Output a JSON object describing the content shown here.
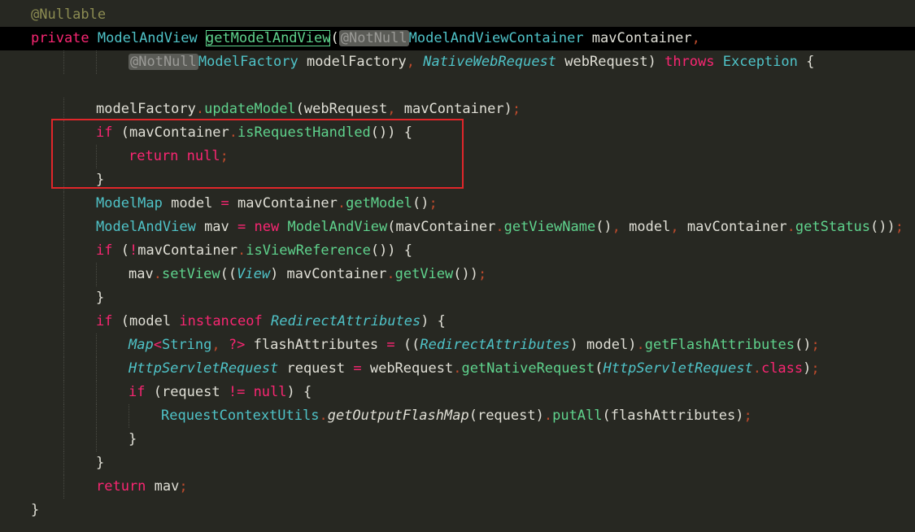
{
  "editor": {
    "language": "Java",
    "highlight_box_color": "#e0262a",
    "lines": [
      {
        "indent": 0,
        "tokens": [
          {
            "t": "@Nullable",
            "c": "ann"
          }
        ]
      },
      {
        "indent": 0,
        "current": true,
        "tokens": [
          {
            "t": "private ",
            "c": "kw"
          },
          {
            "t": "ModelAndView ",
            "c": "ty"
          },
          {
            "t": "getModelAndView",
            "c": "fn",
            "m": 1
          },
          {
            "t": "(",
            "c": "punc"
          },
          {
            "t": "@NotNull",
            "c": "chip"
          },
          {
            "t": "ModelAndViewContainer ",
            "c": "ty"
          },
          {
            "t": "mavContainer",
            "c": "id"
          },
          {
            "t": ",",
            "c": "sep"
          }
        ]
      },
      {
        "indent": 3,
        "tokens": [
          {
            "t": "@NotNull",
            "c": "chip"
          },
          {
            "t": "ModelFactory ",
            "c": "ty"
          },
          {
            "t": "modelFactory",
            "c": "id"
          },
          {
            "t": ", ",
            "c": "sep"
          },
          {
            "t": "NativeWebRequest ",
            "c": "ital"
          },
          {
            "t": "webRequest) ",
            "c": "id"
          },
          {
            "t": "throws ",
            "c": "kw"
          },
          {
            "t": "Exception ",
            "c": "ty"
          },
          {
            "t": "{",
            "c": "punc"
          }
        ]
      },
      {
        "indent": 0,
        "tokens": []
      },
      {
        "indent": 2,
        "tokens": [
          {
            "t": "modelFactory",
            "c": "id"
          },
          {
            "t": ".",
            "c": "sep"
          },
          {
            "t": "updateModel",
            "c": "fn"
          },
          {
            "t": "(webRequest",
            "c": "id"
          },
          {
            "t": ", ",
            "c": "sep"
          },
          {
            "t": "mavContainer)",
            "c": "id"
          },
          {
            "t": ";",
            "c": "sep"
          }
        ]
      },
      {
        "indent": 2,
        "tokens": [
          {
            "t": "if ",
            "c": "kw"
          },
          {
            "t": "(mavContainer",
            "c": "id"
          },
          {
            "t": ".",
            "c": "sep"
          },
          {
            "t": "isRequestHandled",
            "c": "fn"
          },
          {
            "t": "()) {",
            "c": "punc"
          }
        ]
      },
      {
        "indent": 3,
        "tokens": [
          {
            "t": "return ",
            "c": "kw"
          },
          {
            "t": "null",
            "c": "kw"
          },
          {
            "t": ";",
            "c": "sep"
          }
        ]
      },
      {
        "indent": 2,
        "tokens": [
          {
            "t": "}",
            "c": "punc"
          }
        ]
      },
      {
        "indent": 2,
        "tokens": [
          {
            "t": "ModelMap ",
            "c": "ty"
          },
          {
            "t": "model ",
            "c": "id"
          },
          {
            "t": "= ",
            "c": "kw"
          },
          {
            "t": "mavContainer",
            "c": "id"
          },
          {
            "t": ".",
            "c": "sep"
          },
          {
            "t": "getModel",
            "c": "fn"
          },
          {
            "t": "()",
            "c": "punc"
          },
          {
            "t": ";",
            "c": "sep"
          }
        ]
      },
      {
        "indent": 2,
        "tokens": [
          {
            "t": "ModelAndView ",
            "c": "ty"
          },
          {
            "t": "mav ",
            "c": "id"
          },
          {
            "t": "= ",
            "c": "kw"
          },
          {
            "t": "new ",
            "c": "kw"
          },
          {
            "t": "ModelAndView",
            "c": "fn"
          },
          {
            "t": "(mavContainer",
            "c": "id"
          },
          {
            "t": ".",
            "c": "sep"
          },
          {
            "t": "getViewName",
            "c": "fn"
          },
          {
            "t": "()",
            "c": "punc"
          },
          {
            "t": ", ",
            "c": "sep"
          },
          {
            "t": "model",
            "c": "id"
          },
          {
            "t": ", ",
            "c": "sep"
          },
          {
            "t": "mavContainer",
            "c": "id"
          },
          {
            "t": ".",
            "c": "sep"
          },
          {
            "t": "getStatus",
            "c": "fn"
          },
          {
            "t": "())",
            "c": "punc"
          },
          {
            "t": ";",
            "c": "sep"
          }
        ]
      },
      {
        "indent": 2,
        "tokens": [
          {
            "t": "if ",
            "c": "kw"
          },
          {
            "t": "(",
            "c": "punc"
          },
          {
            "t": "!",
            "c": "kw"
          },
          {
            "t": "mavContainer",
            "c": "id"
          },
          {
            "t": ".",
            "c": "sep"
          },
          {
            "t": "isViewReference",
            "c": "fn"
          },
          {
            "t": "()) {",
            "c": "punc"
          }
        ]
      },
      {
        "indent": 3,
        "tokens": [
          {
            "t": "mav",
            "c": "id"
          },
          {
            "t": ".",
            "c": "sep"
          },
          {
            "t": "setView",
            "c": "fn"
          },
          {
            "t": "((",
            "c": "punc"
          },
          {
            "t": "View",
            "c": "ital"
          },
          {
            "t": ") mavContainer",
            "c": "id"
          },
          {
            "t": ".",
            "c": "sep"
          },
          {
            "t": "getView",
            "c": "fn"
          },
          {
            "t": "())",
            "c": "punc"
          },
          {
            "t": ";",
            "c": "sep"
          }
        ]
      },
      {
        "indent": 2,
        "tokens": [
          {
            "t": "}",
            "c": "punc"
          }
        ]
      },
      {
        "indent": 2,
        "tokens": [
          {
            "t": "if ",
            "c": "kw"
          },
          {
            "t": "(model ",
            "c": "id"
          },
          {
            "t": "instanceof ",
            "c": "kw"
          },
          {
            "t": "RedirectAttributes",
            "c": "ital"
          },
          {
            "t": ") {",
            "c": "punc"
          }
        ]
      },
      {
        "indent": 3,
        "tokens": [
          {
            "t": "Map",
            "c": "ital"
          },
          {
            "t": "<",
            "c": "kw"
          },
          {
            "t": "String",
            "c": "ty"
          },
          {
            "t": ", ",
            "c": "sep"
          },
          {
            "t": "?",
            "c": "kw"
          },
          {
            "t": "> ",
            "c": "kw"
          },
          {
            "t": "flashAttributes ",
            "c": "id"
          },
          {
            "t": "= ",
            "c": "kw"
          },
          {
            "t": "((",
            "c": "punc"
          },
          {
            "t": "RedirectAttributes",
            "c": "ital"
          },
          {
            "t": ") model)",
            "c": "id"
          },
          {
            "t": ".",
            "c": "sep"
          },
          {
            "t": "getFlashAttributes",
            "c": "fn"
          },
          {
            "t": "()",
            "c": "punc"
          },
          {
            "t": ";",
            "c": "sep"
          }
        ]
      },
      {
        "indent": 3,
        "tokens": [
          {
            "t": "HttpServletRequest ",
            "c": "ital"
          },
          {
            "t": "request ",
            "c": "id"
          },
          {
            "t": "= ",
            "c": "kw"
          },
          {
            "t": "webRequest",
            "c": "id"
          },
          {
            "t": ".",
            "c": "sep"
          },
          {
            "t": "getNativeRequest",
            "c": "fn"
          },
          {
            "t": "(",
            "c": "punc"
          },
          {
            "t": "HttpServletRequest",
            "c": "ital"
          },
          {
            "t": ".",
            "c": "sep"
          },
          {
            "t": "class",
            "c": "kw"
          },
          {
            "t": ")",
            "c": "punc"
          },
          {
            "t": ";",
            "c": "sep"
          }
        ]
      },
      {
        "indent": 3,
        "tokens": [
          {
            "t": "if ",
            "c": "kw"
          },
          {
            "t": "(request ",
            "c": "id"
          },
          {
            "t": "!= ",
            "c": "kw"
          },
          {
            "t": "null",
            "c": "kw"
          },
          {
            "t": ") {",
            "c": "punc"
          }
        ]
      },
      {
        "indent": 4,
        "tokens": [
          {
            "t": "RequestContextUtils",
            "c": "ty"
          },
          {
            "t": ".",
            "c": "sep"
          },
          {
            "t": "getOutputFlashMap",
            "c": "static"
          },
          {
            "t": "(request)",
            "c": "id"
          },
          {
            "t": ".",
            "c": "sep"
          },
          {
            "t": "putAll",
            "c": "fn"
          },
          {
            "t": "(flashAttributes)",
            "c": "id"
          },
          {
            "t": ";",
            "c": "sep"
          }
        ]
      },
      {
        "indent": 3,
        "tokens": [
          {
            "t": "}",
            "c": "punc"
          }
        ]
      },
      {
        "indent": 2,
        "tokens": [
          {
            "t": "}",
            "c": "punc"
          }
        ]
      },
      {
        "indent": 2,
        "tokens": [
          {
            "t": "return ",
            "c": "kw"
          },
          {
            "t": "mav",
            "c": "id"
          },
          {
            "t": ";",
            "c": "sep"
          }
        ]
      },
      {
        "indent": 0,
        "tokens": [
          {
            "t": "}",
            "c": "punc"
          }
        ]
      }
    ]
  }
}
